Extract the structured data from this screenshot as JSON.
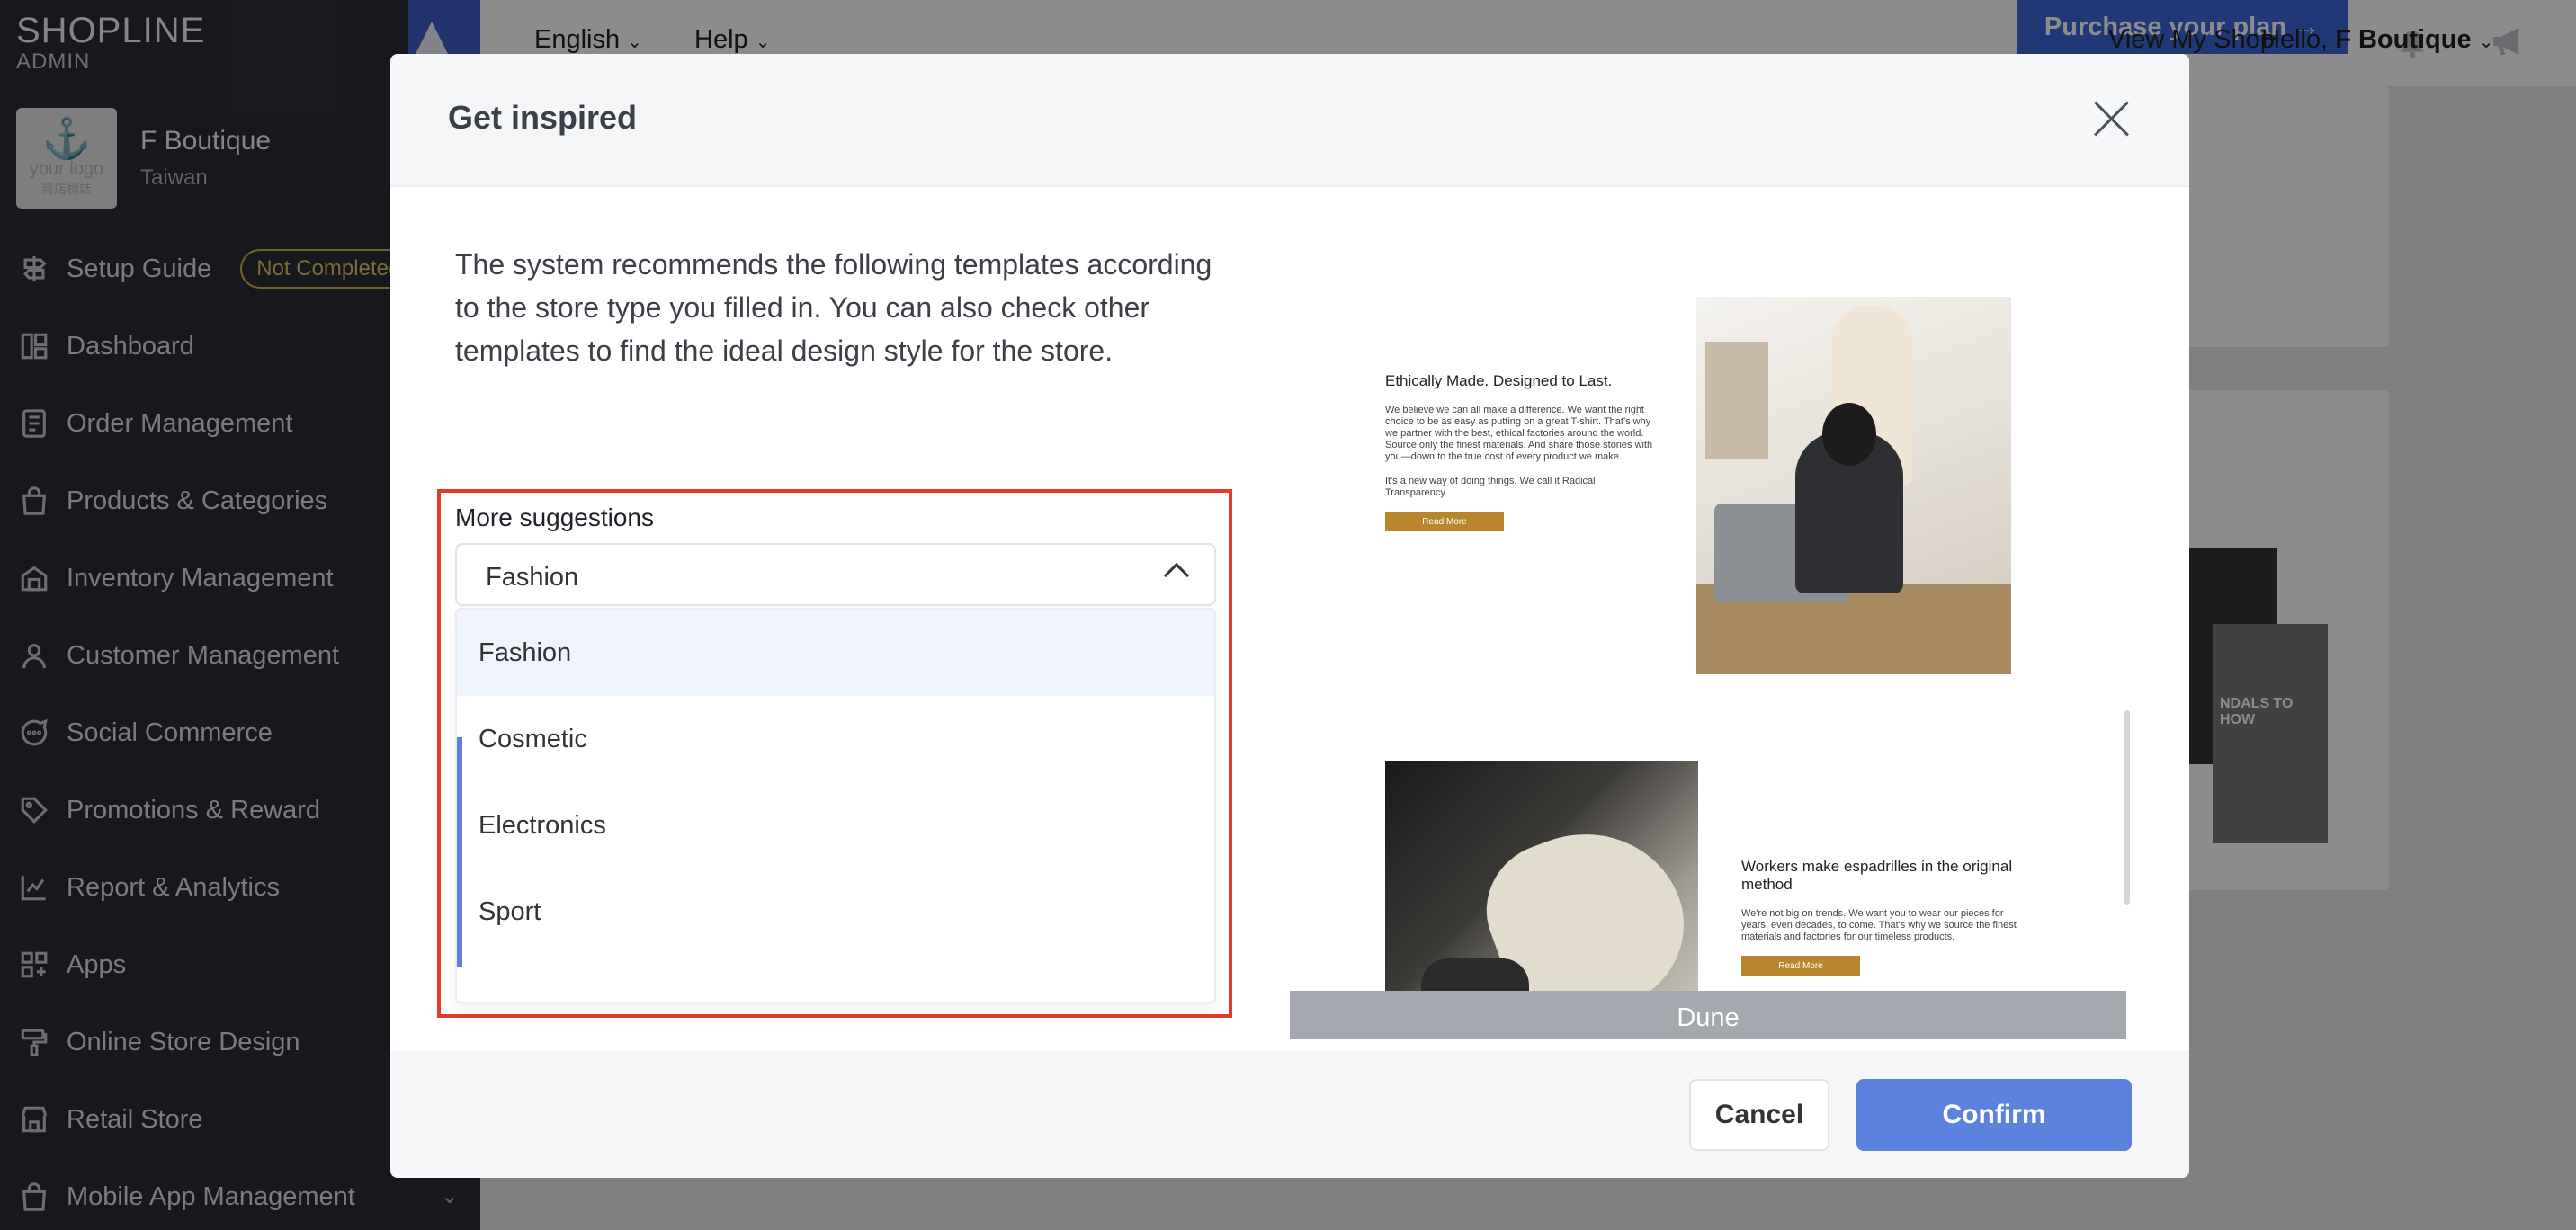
{
  "app": {
    "logo_main": "SHOP",
    "logo_main_rest": "LINE",
    "logo_sub": "ADMIN"
  },
  "store": {
    "logo_text": "your logo",
    "logo_subtext": "商店標誌",
    "name": "F Boutique",
    "region": "Taiwan"
  },
  "sidebar": {
    "items": [
      {
        "label": "Setup Guide",
        "icon": "signpost-icon",
        "badge": "Not Completed"
      },
      {
        "label": "Dashboard",
        "icon": "dashboard-icon"
      },
      {
        "label": "Order Management",
        "icon": "order-icon"
      },
      {
        "label": "Products & Categories",
        "icon": "bag-icon"
      },
      {
        "label": "Inventory Management",
        "icon": "inventory-icon"
      },
      {
        "label": "Customer Management",
        "icon": "person-icon"
      },
      {
        "label": "Social Commerce",
        "icon": "chat-icon"
      },
      {
        "label": "Promotions & Reward",
        "icon": "tag-icon"
      },
      {
        "label": "Report & Analytics",
        "icon": "chart-icon"
      },
      {
        "label": "Apps",
        "icon": "apps-icon"
      },
      {
        "label": "Online Store Design",
        "icon": "paint-icon"
      },
      {
        "label": "Retail Store",
        "icon": "store-icon"
      },
      {
        "label": "Mobile App Management",
        "icon": "bag-icon"
      }
    ]
  },
  "topbar": {
    "language": "English",
    "help": "Help",
    "purchase": "Purchase your plan →",
    "view_shop": "View My Shop",
    "greeting": "Hello, ",
    "user": "F Boutique"
  },
  "modal": {
    "title": "Get inspired",
    "description": "The system recommends the following templates according to the store type you filled in. You can also check other templates to find the ideal design style for the store.",
    "more_label": "More suggestions",
    "selected": "Fashion",
    "options": [
      "Fashion",
      "Cosmetic",
      "Electronics",
      "Sport"
    ],
    "cancel": "Cancel",
    "confirm": "Confirm"
  },
  "templates": {
    "t1": {
      "heading": "Ethically Made. Designed to Last.",
      "para1": "We believe we can all make a difference. We want the right choice to be as easy as putting on a great T-shirt. That's why we partner with the best, ethical factories around the world. Source only the finest materials. And share those stories with you—down to the true cost of every product we make.",
      "para2": "It's a new way of doing things. We call it Radical Transparency.",
      "button": "Read More"
    },
    "t2": {
      "heading": "Workers make espadrilles in the original method",
      "para1": "We're not big on trends. We want you to wear our pieces for years, even decades, to come. That's why we source the finest materials and factories for our timeless products.",
      "button": "Read More",
      "caption": "Dune"
    }
  },
  "background": {
    "thumb_text": "NDALS TO\nHOW"
  }
}
